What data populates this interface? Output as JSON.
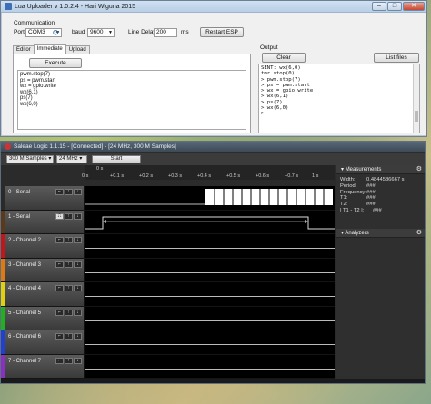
{
  "lua": {
    "title": "Lua Uploader v 1.0.2.4 - Hari Wiguna 2015",
    "communication_label": "Communication",
    "port_label": "Port",
    "port_value": "COM3",
    "baud_label": "baud",
    "baud_value": "9600",
    "line_delay_label": "Line Delay",
    "line_delay_value": "200",
    "ms_label": "ms",
    "restart_button": "Restart ESP",
    "tabs": [
      "Editor",
      "Immediate",
      "Upload"
    ],
    "execute_button": "Execute",
    "code_lines": [
      "pwm.stop(7)",
      "ps = pwm.start",
      "wx = gpio.write",
      "wx(6,1)",
      "ps(7)",
      "wx(6,0)"
    ],
    "output_label": "Output",
    "clear_button": "Clear",
    "list_files_button": "List files",
    "output_lines": [
      "SENT: wx(6,0)",
      "tmr.stop(0)",
      "> pwm.stop(7)",
      "> ps = pwm.start",
      "> wx = gpio.write",
      "> wx(6,1)",
      "> ps(7)",
      "> wx(6,0)",
      ">"
    ]
  },
  "saleae": {
    "title": "Saleae Logic 1.1.15 - [Connected] - [24 MHz, 300 M Samples]",
    "samples": "300 M Samples",
    "rate": "24 MHz",
    "start_button": "Start",
    "ruler_top": [
      "0 s"
    ],
    "ruler_bottom": [
      "+0.1 s",
      "+0.2 s",
      "+0.3 s",
      "+0.4 s",
      "+0.5 s",
      "+0.6 s",
      "+0.7 s",
      "+0.8 s",
      "+0.9 s"
    ],
    "ruler_left_marker": "0 s",
    "ruler_right_marker": "1 s",
    "channels": [
      {
        "name": "0 - Serial",
        "color": "#2a2a2a"
      },
      {
        "name": "1 - Serial",
        "color": "#5a3a1a"
      },
      {
        "name": "2 - Channel 2",
        "color": "#c0181a"
      },
      {
        "name": "3 - Channel 3",
        "color": "#e07a10"
      },
      {
        "name": "4 - Channel 4",
        "color": "#e0d010"
      },
      {
        "name": "5 - Channel 5",
        "color": "#20b020"
      },
      {
        "name": "6 - Channel 6",
        "color": "#2040d0"
      },
      {
        "name": "7 - Channel 7",
        "color": "#8a30c0"
      }
    ],
    "measurements_label": "Measurements",
    "measurements": [
      {
        "k": "Width:",
        "v": "0.4844586667 s"
      },
      {
        "k": "Period:",
        "v": "###"
      },
      {
        "k": "Frequency:",
        "v": "###"
      },
      {
        "k": "T1:",
        "v": "###"
      },
      {
        "k": "T2:",
        "v": "###"
      },
      {
        "k": "| T1 - T2 |:",
        "v": "###"
      }
    ],
    "analyzers_label": "Analyzers"
  }
}
